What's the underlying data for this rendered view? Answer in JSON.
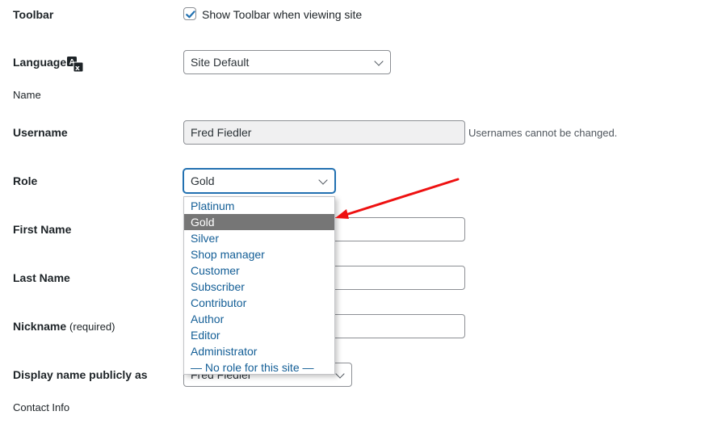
{
  "toolbar": {
    "label": "Toolbar",
    "checkbox_checked": true,
    "checkbox_label": "Show Toolbar when viewing site"
  },
  "language": {
    "label": "Language",
    "icon": "translate-icon",
    "selected": "Site Default"
  },
  "name_section": {
    "heading": "Name"
  },
  "username": {
    "label": "Username",
    "value": "Fred Fiedler",
    "description": "Usernames cannot be changed."
  },
  "role": {
    "label": "Role",
    "selected": "Gold",
    "options": [
      "Platinum",
      "Gold",
      "Silver",
      "Shop manager",
      "Customer",
      "Subscriber",
      "Contributor",
      "Author",
      "Editor",
      "Administrator",
      "— No role for this site —"
    ],
    "highlighted_index": 1
  },
  "first_name": {
    "label": "First Name",
    "value": ""
  },
  "last_name": {
    "label": "Last Name",
    "value": ""
  },
  "nickname": {
    "label": "Nickname",
    "required_note": "(required)",
    "value": ""
  },
  "display_name": {
    "label": "Display name publicly as",
    "selected": "Fred Fiedler"
  },
  "contact_section": {
    "heading": "Contact Info"
  },
  "annotation": {
    "type": "arrow",
    "color": "#ee1111",
    "points_to": "role option Gold"
  },
  "colors": {
    "focus_blue": "#2271b1",
    "option_text": "#135e96",
    "option_highlight_bg": "#767676"
  }
}
